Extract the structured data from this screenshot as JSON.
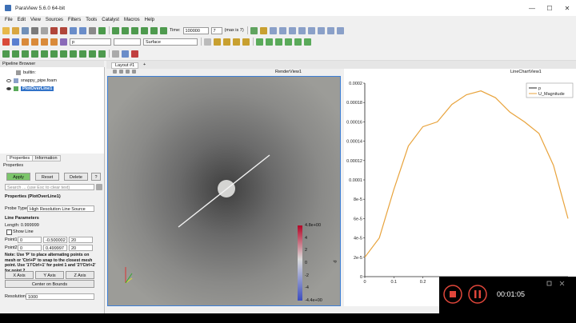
{
  "window": {
    "title": "ParaView 5.6.0 64-bit",
    "minimize": "—",
    "maximize": "☐",
    "close": "✕"
  },
  "menu": [
    "File",
    "Edit",
    "View",
    "Sources",
    "Filters",
    "Tools",
    "Catalyst",
    "Macros",
    "Help"
  ],
  "toolbar": {
    "time_label": "Time:",
    "time_value": "100000",
    "timestep": "7",
    "max_label": "(max is 7)",
    "coloring": "p",
    "representation": "Surface"
  },
  "pipeline": {
    "header": "Pipeline Browser",
    "items": [
      "builtin:",
      "snappy_pipe.foam",
      "PlotOverLine1"
    ]
  },
  "props": {
    "tabs": [
      "Properties",
      "Information"
    ],
    "section": "Properties",
    "apply": "Apply",
    "reset": "Reset",
    "delete": "Delete",
    "help": "?",
    "search_placeholder": "Search ... (use Esc to clear text)",
    "group_title": "Properties (PlotOverLine1)",
    "probe_type_label": "Probe Type",
    "probe_type_value": "High Resolution Line Source",
    "line_params": "Line Parameters",
    "length": "Length: 0.999999",
    "show_line": "Show Line",
    "p1_label": "Point1",
    "p1": [
      "0",
      "-0.500002",
      "20"
    ],
    "p2_label": "Point2",
    "p2": [
      "0",
      "0.499997",
      "20"
    ],
    "note": "Note: Use 'P' to place alternating points on mesh or 'Ctrl+P' to snap to the closest mesh point. Use '1'/'Ctrl+1' for point 1 and '2'/'Ctrl+2' for point 2.",
    "x_axis": "X Axis",
    "y_axis": "Y Axis",
    "z_axis": "Z Axis",
    "center": "Center on Bounds",
    "resolution_label": "Resolution",
    "resolution_value": "1000"
  },
  "layout": {
    "tab": "Layout #1",
    "plus": "+"
  },
  "render": {
    "title": "RenderView1",
    "colorbar_labels": [
      "4.8e+00",
      "4",
      "2",
      "0",
      "-2",
      "-4",
      "-4.4e+00"
    ],
    "colorbar_title": "p"
  },
  "line_view": {
    "title": "LineChartView1"
  },
  "chart_data": {
    "type": "line",
    "series": [
      {
        "name": "p",
        "x": [],
        "y": []
      },
      {
        "name": "U_Magnitude",
        "x": [
          0,
          0.05,
          0.1,
          0.15,
          0.2,
          0.25,
          0.3,
          0.35,
          0.4,
          0.45,
          0.5,
          0.55,
          0.6,
          0.65,
          0.7
        ],
        "y": [
          2e-05,
          4e-05,
          9e-05,
          0.000135,
          0.000155,
          0.00016,
          0.000178,
          0.000188,
          0.000192,
          0.000185,
          0.00017,
          0.00016,
          0.000148,
          0.000115,
          6e-05
        ]
      }
    ],
    "x_ticks": [
      "0",
      "0.1",
      "0.2",
      "0.3"
    ],
    "y_ticks": [
      "0",
      "2e-5",
      "4e-5",
      "6e-5",
      "8e-5",
      "0.0001",
      "0.00012",
      "0.00014",
      "0.00016",
      "0.00018",
      "0.0002"
    ],
    "ylim": [
      0,
      0.0002
    ],
    "xlim": [
      0,
      0.7
    ],
    "legend": "top-right",
    "colors": {
      "U_Magnitude": "#e8a33c",
      "p": "#222222"
    }
  },
  "recorder": {
    "time": "00:01:05"
  }
}
